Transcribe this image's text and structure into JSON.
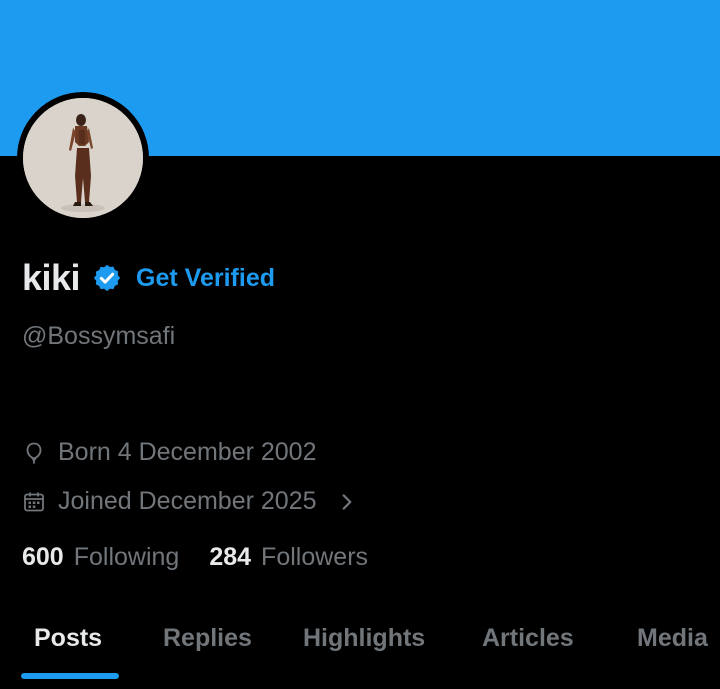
{
  "profile": {
    "display_name": "kiki",
    "get_verified": "Get Verified",
    "handle": "@Bossymsafi",
    "born": "Born 4 December 2002",
    "joined": "Joined December 2025",
    "following_count": "600",
    "following_label": "Following",
    "followers_count": "284",
    "followers_label": "Followers"
  },
  "tabs": [
    {
      "label": "Posts",
      "active": true
    },
    {
      "label": "Replies",
      "active": false
    },
    {
      "label": "Highlights",
      "active": false
    },
    {
      "label": "Articles",
      "active": false
    },
    {
      "label": "Media",
      "active": false
    }
  ],
  "colors": {
    "banner": "#1d9bf0",
    "accent": "#1d9bf0",
    "background": "#000000",
    "primary_text": "#e7e9ea",
    "secondary_text": "#71767b"
  },
  "icons": {
    "verified": "verified-badge-icon",
    "born": "balloon-icon",
    "joined": "calendar-icon",
    "more": "chevron-right-icon"
  }
}
